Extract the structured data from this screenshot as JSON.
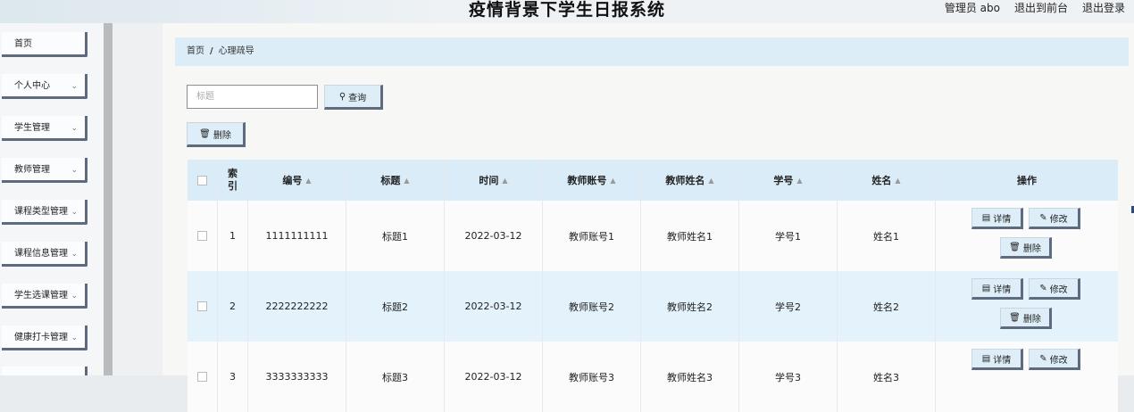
{
  "app": {
    "title": "疫情背景下学生日报系统"
  },
  "topnav": {
    "user": "管理员 abo",
    "front": "退出到前台",
    "logout": "退出登录"
  },
  "sidebar": {
    "items": [
      {
        "label": "首页",
        "has_chevron": false
      },
      {
        "label": "个人中心",
        "has_chevron": true
      },
      {
        "label": "学生管理",
        "has_chevron": true
      },
      {
        "label": "教师管理",
        "has_chevron": true
      },
      {
        "label": "课程类型管理",
        "has_chevron": true
      },
      {
        "label": "课程信息管理",
        "has_chevron": true
      },
      {
        "label": "学生选课管理",
        "has_chevron": true
      },
      {
        "label": "健康打卡管理",
        "has_chevron": true
      }
    ]
  },
  "breadcrumb": {
    "home": "首页",
    "sep": "/",
    "current": "心理疏导"
  },
  "search": {
    "placeholder": "标题",
    "button": "查询"
  },
  "toolbar": {
    "delete": "删除"
  },
  "table": {
    "columns": [
      "索引",
      "编号",
      "标题",
      "时间",
      "教师账号",
      "教师姓名",
      "学号",
      "姓名",
      "操作"
    ],
    "rows": [
      {
        "index": "1",
        "code": "1111111111",
        "title": "标题1",
        "time": "2022-03-12",
        "teacher_account": "教师账号1",
        "teacher_name": "教师姓名1",
        "student_no": "学号1",
        "name": "姓名1"
      },
      {
        "index": "2",
        "code": "2222222222",
        "title": "标题2",
        "time": "2022-03-12",
        "teacher_account": "教师账号2",
        "teacher_name": "教师姓名2",
        "student_no": "学号2",
        "name": "姓名2"
      },
      {
        "index": "3",
        "code": "3333333333",
        "title": "标题3",
        "time": "2022-03-12",
        "teacher_account": "教师账号3",
        "teacher_name": "教师姓名3",
        "student_no": "学号3",
        "name": "姓名3"
      }
    ],
    "actions": {
      "detail": "详情",
      "edit": "修改",
      "delete": "删除"
    }
  },
  "icons": {
    "search": "search-icon",
    "delete": "trash-icon",
    "detail": "document-icon",
    "edit": "pencil-icon",
    "chevron": "chevron-down-icon"
  }
}
